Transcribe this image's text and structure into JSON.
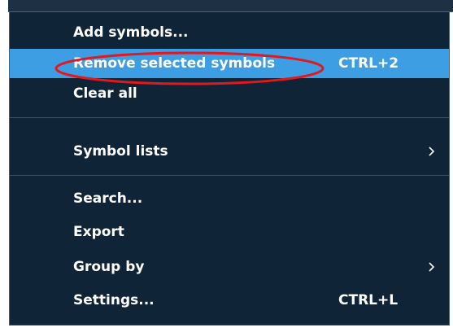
{
  "context_menu": {
    "items": [
      {
        "label": "Add symbols...",
        "shortcut": "",
        "has_submenu": false
      },
      {
        "label": "Remove selected symbols",
        "shortcut": "CTRL+2",
        "has_submenu": false,
        "selected": true
      },
      {
        "label": "Clear all",
        "shortcut": "",
        "has_submenu": false
      },
      {
        "label": "Symbol lists",
        "shortcut": "",
        "has_submenu": true
      },
      {
        "label": "Search...",
        "shortcut": "",
        "has_submenu": false
      },
      {
        "label": "Export",
        "shortcut": "",
        "has_submenu": false
      },
      {
        "label": "Group by",
        "shortcut": "",
        "has_submenu": true
      },
      {
        "label": "Settings...",
        "shortcut": "CTRL+L",
        "has_submenu": false
      }
    ]
  },
  "colors": {
    "menu_background": "#0f2437",
    "highlight": "#3d9ee4",
    "text": "#ffffff",
    "annotation": "#e0191e"
  },
  "icons": {
    "submenu": "chevron-right-icon"
  }
}
